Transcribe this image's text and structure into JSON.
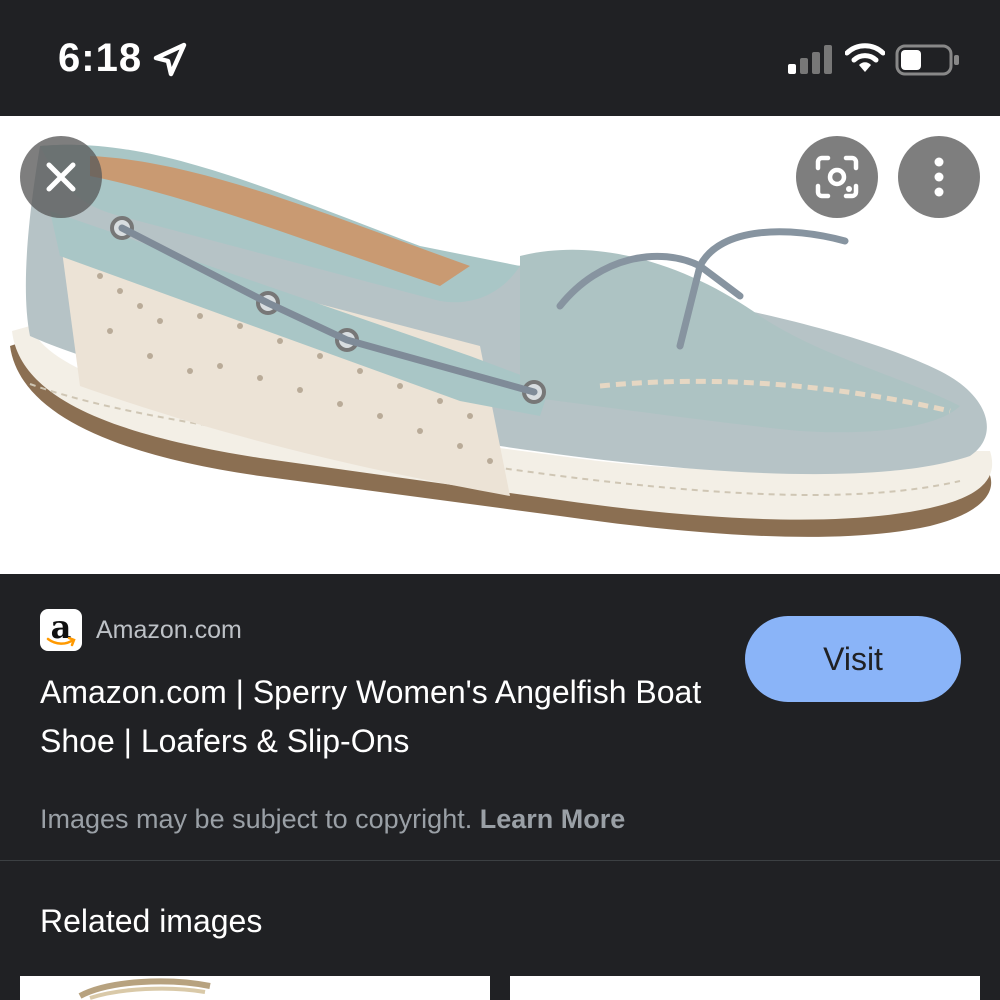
{
  "status_bar": {
    "time": "6:18",
    "icons": [
      "location-arrow-icon",
      "cellular-signal-icon",
      "wifi-icon",
      "battery-icon"
    ]
  },
  "viewer": {
    "image_subject": "light blue boat shoe with tan mesh side panel and grey laces",
    "buttons": [
      "close-icon",
      "lens-icon",
      "more-vert-icon"
    ]
  },
  "result": {
    "source": "Amazon.com",
    "favicon_letter": "a",
    "title": "Amazon.com | Sperry Women's Angelfish Boat Shoe | Loafers & Slip-Ons",
    "visit_label": "Visit",
    "copyright_text": "Images may be subject to copyright.",
    "learn_more_label": "Learn More"
  },
  "related": {
    "heading": "Related images"
  },
  "colors": {
    "background": "#202124",
    "accent": "#8ab4f8",
    "muted_text": "#9aa0a6",
    "amazon_orange": "#f90"
  }
}
